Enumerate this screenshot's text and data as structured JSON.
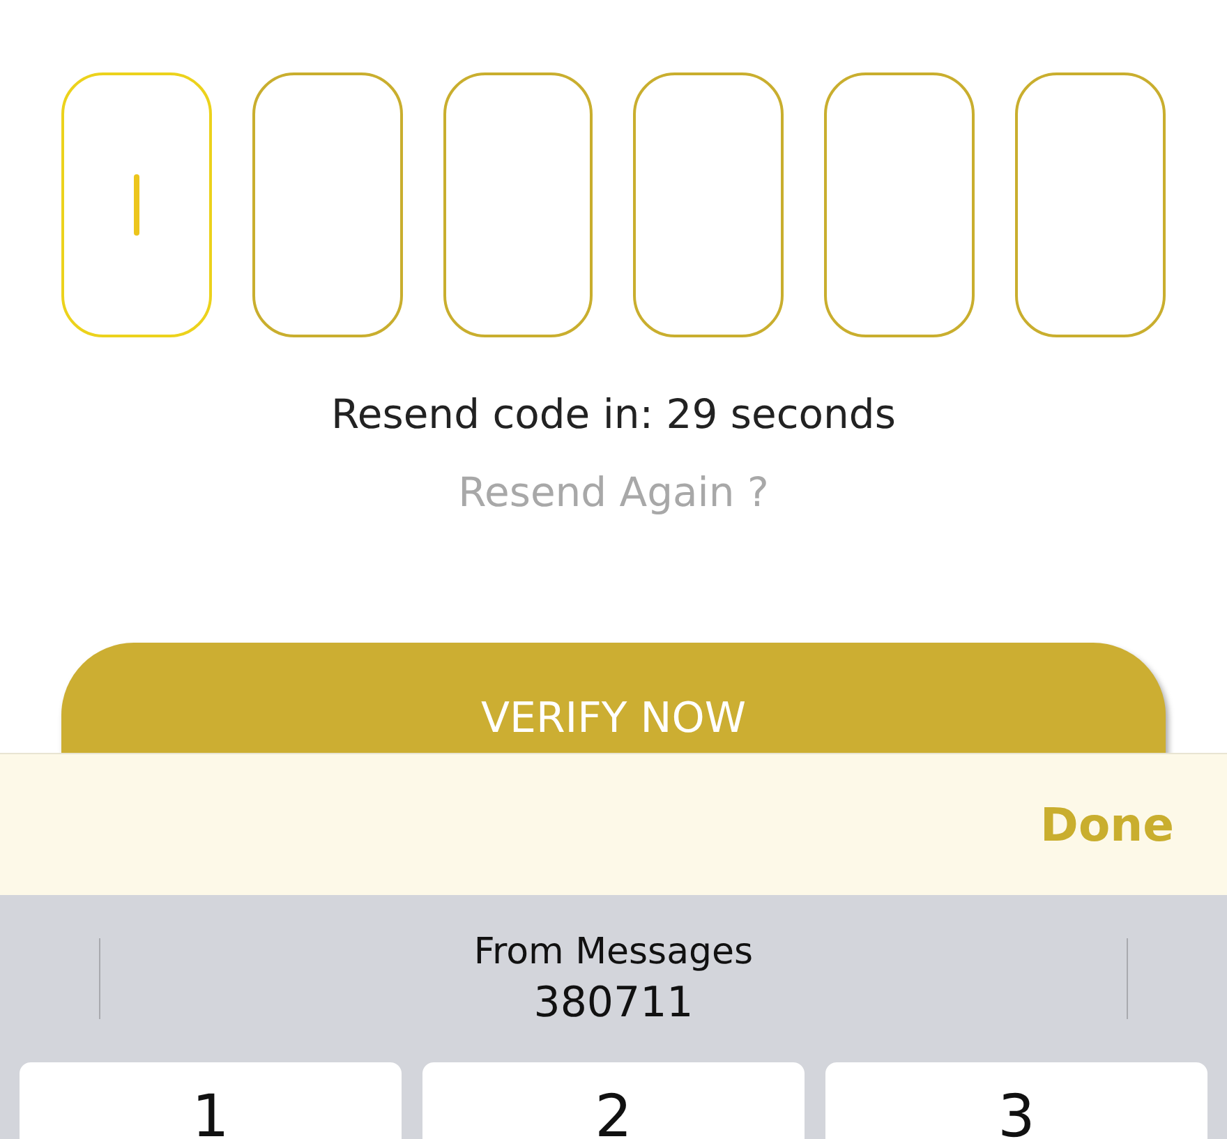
{
  "code_boxes": [
    {
      "focused": true
    },
    {
      "focused": false
    },
    {
      "focused": false
    },
    {
      "focused": false
    },
    {
      "focused": false
    },
    {
      "focused": false
    }
  ],
  "resend_timer": "Resend code in: 29 seconds",
  "resend_link": {
    "label": "Resend Again ?",
    "disabled": true
  },
  "verify_button": "VERIFY NOW",
  "keyboard_toolbar": {
    "done": "Done"
  },
  "suggestion": {
    "source": "From Messages",
    "code": "380711"
  },
  "keys": [
    "1",
    "2",
    "3"
  ]
}
